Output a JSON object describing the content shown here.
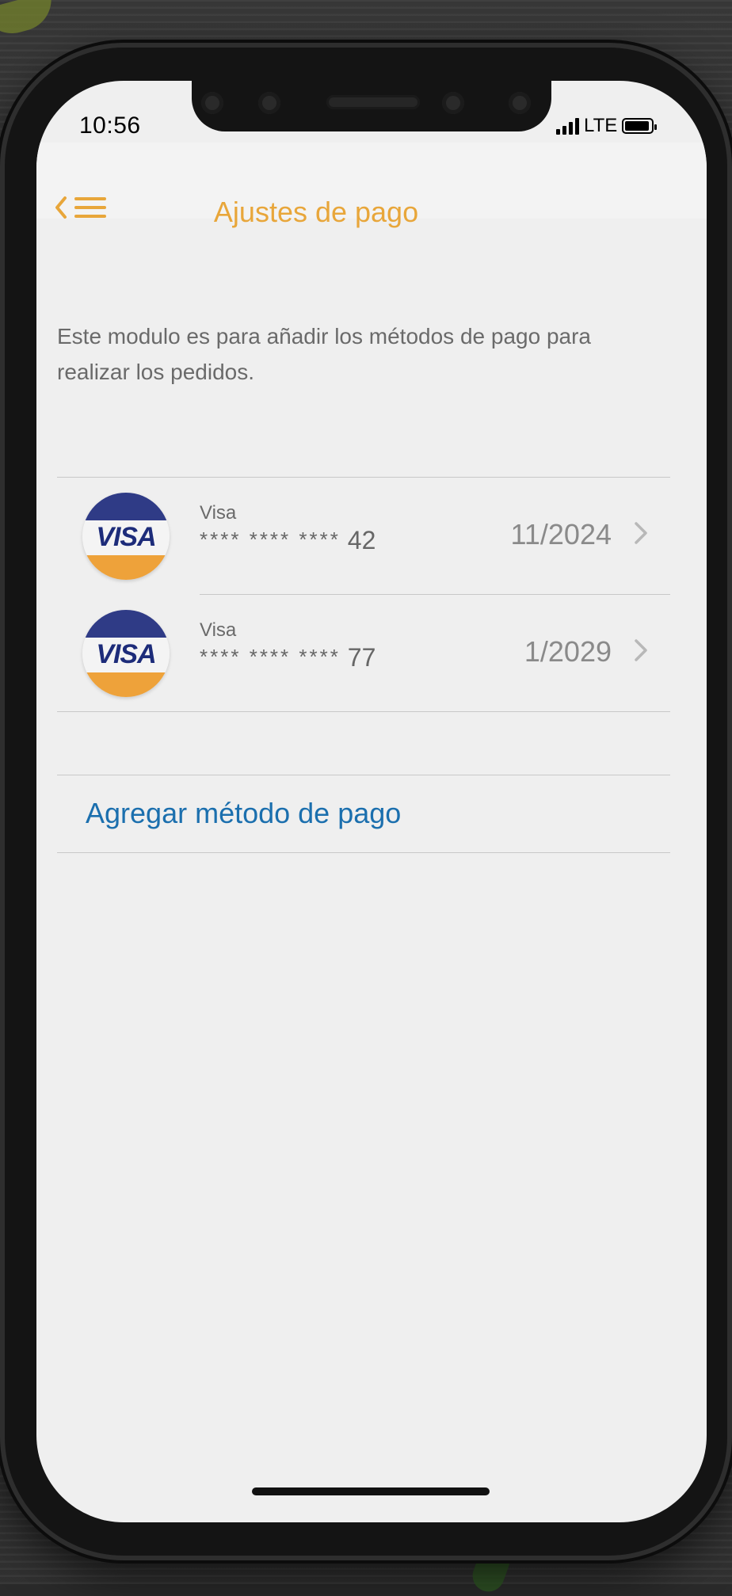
{
  "status_bar": {
    "time": "10:56",
    "network": "LTE"
  },
  "header": {
    "title": "Ajustes de pago",
    "back_icon": "chevron-left-icon",
    "menu_icon": "hamburger-menu-icon",
    "accent_color": "#e8a63a"
  },
  "description": "Este modulo es para añadir los métodos de pago para realizar los pedidos.",
  "cards": [
    {
      "brand": "Visa",
      "logo_text": "VISA",
      "masked": "**** **** ****",
      "last_digits": "42",
      "expiry": "11/2024"
    },
    {
      "brand": "Visa",
      "logo_text": "VISA",
      "masked": "**** **** ****",
      "last_digits": "77",
      "expiry": "1/2029"
    }
  ],
  "add_method": {
    "label": "Agregar método de pago",
    "color": "#1b6fae"
  }
}
